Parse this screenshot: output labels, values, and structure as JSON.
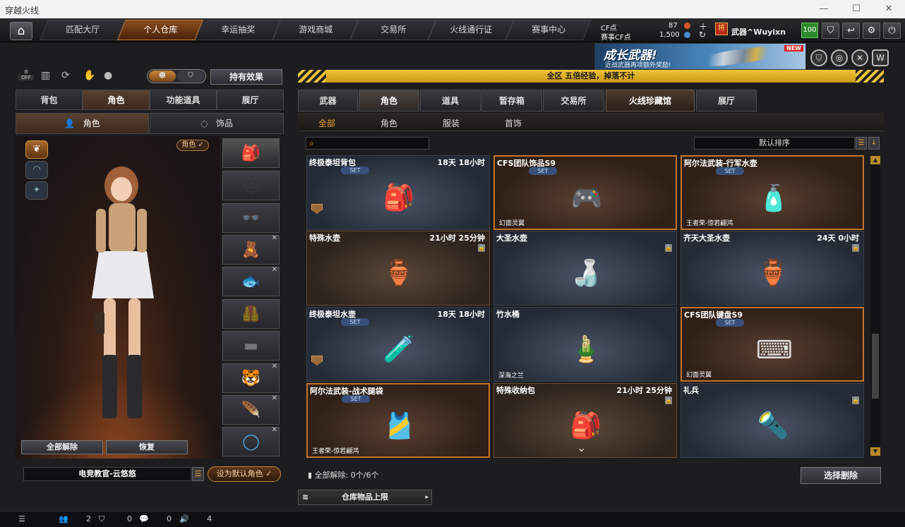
{
  "window": {
    "title": "穿越火线"
  },
  "nav": {
    "tabs": [
      "匹配大厅",
      "个人仓库",
      "幸运抽奖",
      "游戏商城",
      "交易所",
      "火线通行证",
      "赛事中心"
    ],
    "active": 1
  },
  "currency": {
    "cf_label": "CF点",
    "cf_value": "87",
    "event_cf_label": "赛事CF点",
    "event_cf_value": "1,500"
  },
  "user": {
    "rank_label": "将",
    "name": "武器^Wuyixn",
    "level": "100"
  },
  "banner": {
    "title": "成长武器!",
    "subtitle": "近战武器再项额外奖励!",
    "new_tag": "NEW"
  },
  "announcement": "全区 五倍经验，掉落不计",
  "left": {
    "off_label": "OFF",
    "effects_button": "持有效果",
    "tabs": [
      "背包",
      "角色",
      "功能道具",
      "展厅"
    ],
    "subtabs": [
      "角色",
      "饰品"
    ],
    "role_tag": "角色",
    "unequip_all": "全部解除",
    "restore": "恢复",
    "character_name": "电竞教官-云悠悠",
    "set_default": "设为默认角色"
  },
  "right": {
    "tabs": [
      "武器",
      "角色",
      "道具",
      "暂存箱",
      "交易所",
      "火线珍藏馆",
      "展厅"
    ],
    "filters": [
      "全部",
      "角色",
      "服装",
      "首饰"
    ],
    "sort_label": "默认排序",
    "cards": [
      {
        "name": "终极泰坦背包",
        "time": "18天 18小时",
        "set": "SET",
        "footer": "",
        "style": "cool",
        "icon": "🎒",
        "lock": false,
        "badge": true
      },
      {
        "name": "CFS团队饰品S9",
        "time": "",
        "set": "SET",
        "footer": "幻面灵翼",
        "style": "orange",
        "icon": "🎮",
        "lock": false,
        "badge": false
      },
      {
        "name": "阿尔法武装-行军水壶",
        "time": "",
        "set": "SET",
        "footer": "王者荣-惊若翩鸿",
        "style": "orange",
        "icon": "🧴",
        "lock": false,
        "badge": false
      },
      {
        "name": "特殊水壶",
        "time": "21小时 25分钟",
        "set": "",
        "footer": "",
        "style": "warm",
        "icon": "🏺",
        "lock": true,
        "badge": false
      },
      {
        "name": "大圣水壶",
        "time": "",
        "set": "",
        "footer": "",
        "style": "cool",
        "icon": "🍶",
        "lock": true,
        "badge": false
      },
      {
        "name": "齐天大圣水壶",
        "time": "24天 0小时",
        "set": "",
        "footer": "",
        "style": "cool",
        "icon": "🏺",
        "lock": true,
        "badge": false
      },
      {
        "name": "终极泰坦水壶",
        "time": "18天 18小时",
        "set": "SET",
        "footer": "",
        "style": "cool",
        "icon": "🧪",
        "lock": false,
        "badge": true
      },
      {
        "name": "竹水桶",
        "time": "",
        "set": "",
        "footer": "深海之兰",
        "style": "cool",
        "icon": "🎍",
        "lock": false,
        "badge": false
      },
      {
        "name": "CFS团队键盘S9",
        "time": "",
        "set": "SET",
        "footer": "幻面灵翼",
        "style": "orange",
        "icon": "⌨",
        "lock": false,
        "badge": false
      },
      {
        "name": "阿尔法武装-战术腿袋",
        "time": "",
        "set": "SET",
        "footer": "王者荣-惊若翩鸿",
        "style": "orange",
        "icon": "🎽",
        "lock": false,
        "badge": false
      },
      {
        "name": "特殊收纳包",
        "time": "21小时 25分钟",
        "set": "",
        "footer": "",
        "style": "warm",
        "icon": "🎒",
        "lock": true,
        "badge": false
      },
      {
        "name": "礼兵",
        "time": "",
        "set": "",
        "footer": "",
        "style": "cool",
        "icon": "🔦",
        "lock": true,
        "badge": false
      }
    ],
    "unequip_status": "全部解除: 0个/6个",
    "select_delete": "选择删除",
    "storage_limit": "仓库物品上限"
  },
  "bottom": {
    "friends": "2",
    "shield": "0",
    "chat": "0",
    "voice": "4"
  }
}
